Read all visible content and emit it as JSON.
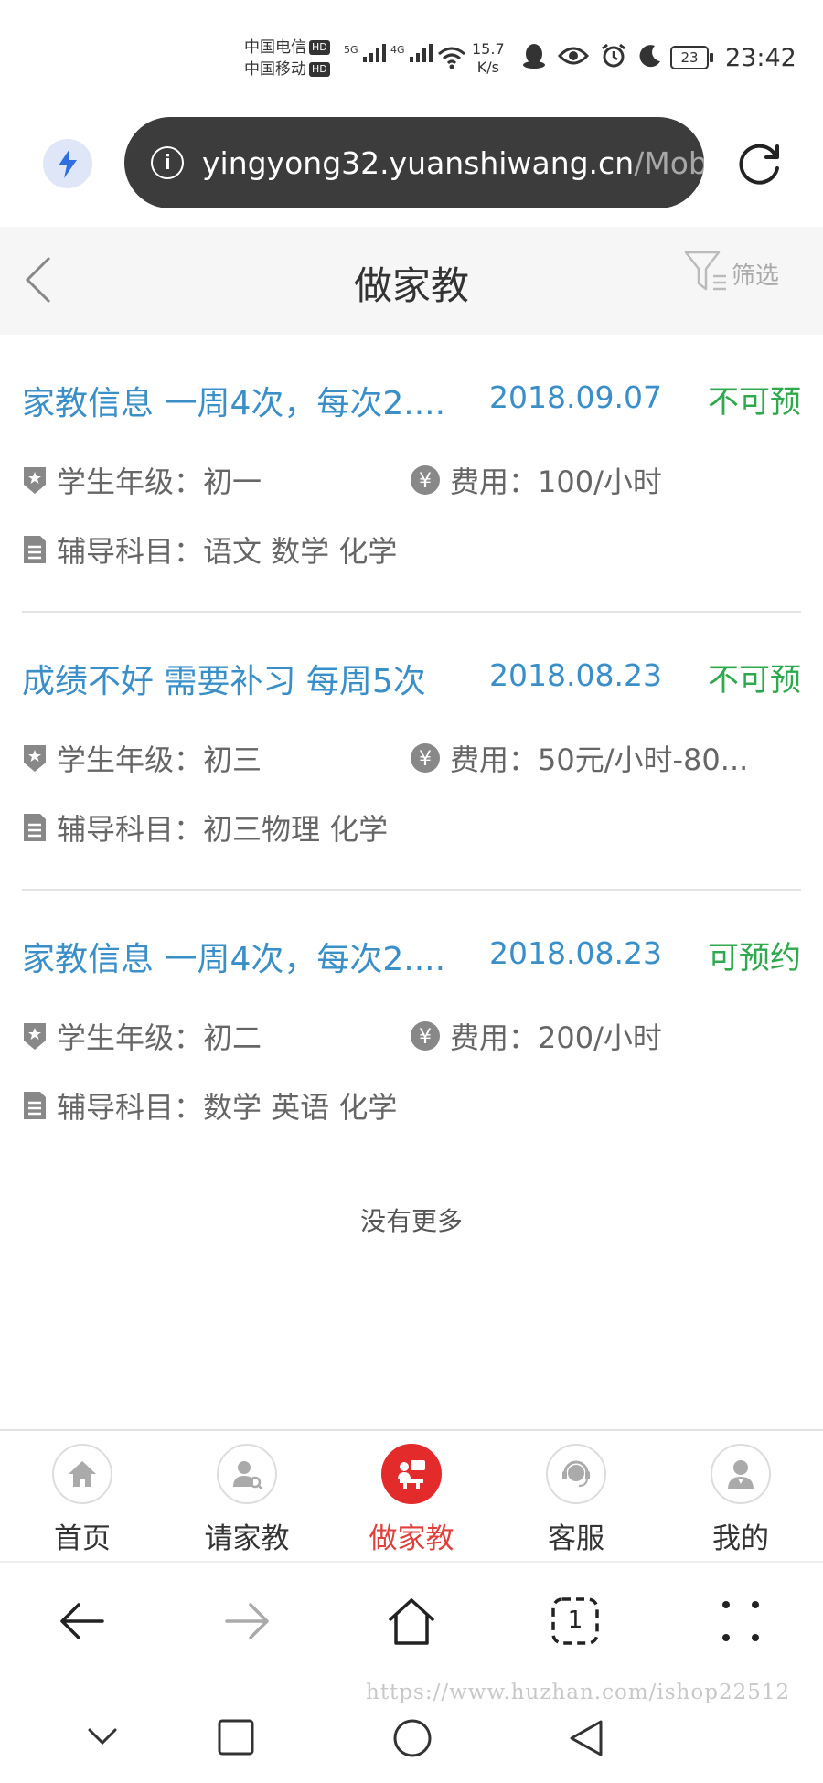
{
  "status": {
    "carrier1": "中国电信",
    "carrier2": "中国移动",
    "hd": "HD",
    "net1": "5G",
    "net2": "4G",
    "speed_value": "15.7",
    "speed_unit": "K/s",
    "battery": "23",
    "time": "23:42"
  },
  "browser": {
    "url_main": "yingyong32.yuanshiwang.cn",
    "url_rest": "/Mobi"
  },
  "header": {
    "title": "做家教",
    "filter_label": "筛选"
  },
  "listings": [
    {
      "title": "家教信息 一周4次，每次2....",
      "date": "2018.09.07",
      "status": "不可预",
      "grade": "学生年级：初一",
      "fee": "费用：100/小时",
      "subjects": "辅导科目：语文 数学 化学"
    },
    {
      "title": "成绩不好 需要补习 每周5次",
      "date": "2018.08.23",
      "status": "不可预",
      "grade": "学生年级：初三",
      "fee": "费用：50元/小时-80...",
      "subjects": "辅导科目：初三物理 化学"
    },
    {
      "title": "家教信息 一周4次，每次2....",
      "date": "2018.08.23",
      "status": "可预约",
      "grade": "学生年级：初二",
      "fee": "费用：200/小时",
      "subjects": "辅导科目：数学 英语 化学"
    }
  ],
  "no_more": "没有更多",
  "tabs": [
    {
      "label": "首页",
      "icon": "home-icon"
    },
    {
      "label": "请家教",
      "icon": "find-tutor-icon"
    },
    {
      "label": "做家教",
      "icon": "be-tutor-icon",
      "active": true
    },
    {
      "label": "客服",
      "icon": "customer-service-icon"
    },
    {
      "label": "我的",
      "icon": "profile-icon"
    }
  ],
  "browser_nav": {
    "tab_count": "1"
  },
  "watermark": "https://www.huzhan.com/ishop22512",
  "colors": {
    "link_blue": "#3a8fc8",
    "status_green": "#2fa94e",
    "active_red": "#e32b2b"
  }
}
